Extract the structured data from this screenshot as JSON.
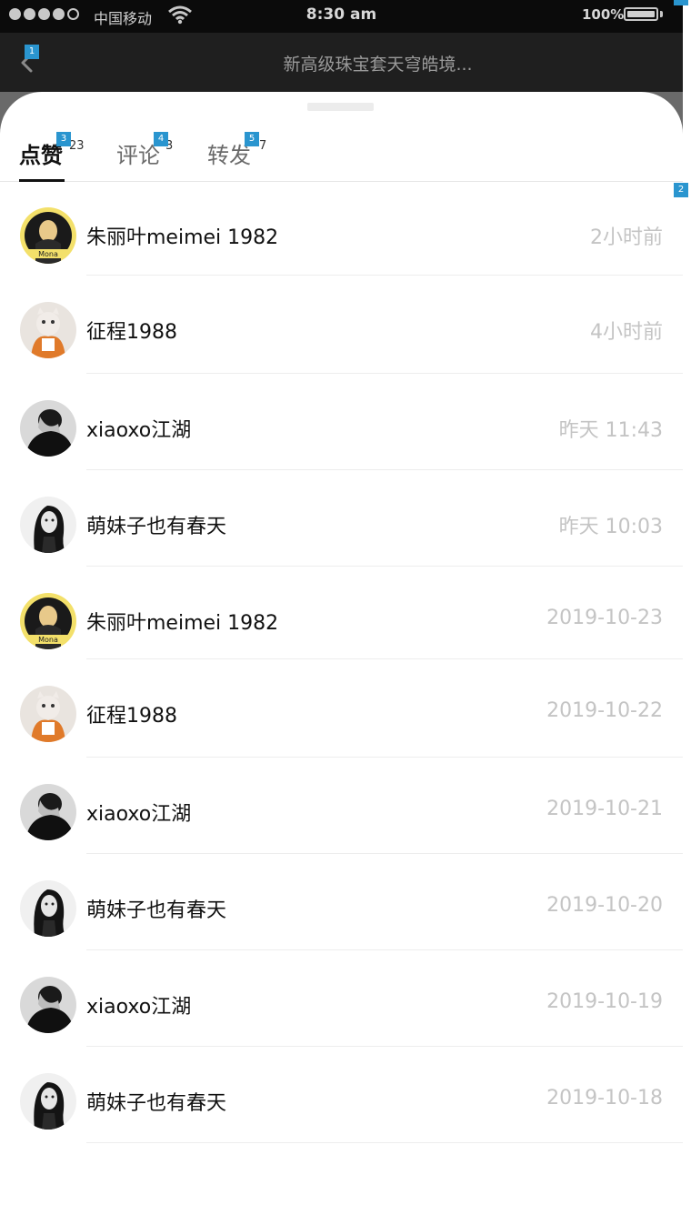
{
  "status_bar": {
    "carrier": "中国移动",
    "time": "8:30 am",
    "battery_percent": "100%",
    "battery_level": 1.0,
    "signal_bars": 5,
    "signal_filled": 4,
    "icons": [
      "signal-icon",
      "wifi-icon",
      "battery-icon"
    ]
  },
  "nav": {
    "title": "新高级珠宝套天穹皓境...",
    "back_icon": "chevron-left-icon"
  },
  "tabs": [
    {
      "label": "点赞",
      "count": "23",
      "active": true
    },
    {
      "label": "评论",
      "count": "3",
      "active": false
    },
    {
      "label": "转发",
      "count": "7",
      "active": false
    }
  ],
  "list": [
    {
      "name": "朱丽叶meimei  1982",
      "time": "2小时前",
      "avatar": "mona-lisa"
    },
    {
      "name": "征程1988",
      "time": "4小时前",
      "avatar": "cat-plush"
    },
    {
      "name": "xiaoxo江湖",
      "time": "昨天 11:43",
      "avatar": "man-dark"
    },
    {
      "name": "萌妹子也有春天",
      "time": "昨天 10:03",
      "avatar": "woman-bw"
    },
    {
      "name": "朱丽叶meimei  1982",
      "time": "2019-10-23",
      "avatar": "mona-lisa"
    },
    {
      "name": "征程1988",
      "time": "2019-10-22",
      "avatar": "cat-plush"
    },
    {
      "name": "xiaoxo江湖",
      "time": "2019-10-21",
      "avatar": "man-dark"
    },
    {
      "name": "萌妹子也有春天",
      "time": "2019-10-20",
      "avatar": "woman-bw"
    },
    {
      "name": "xiaoxo江湖",
      "time": "2019-10-19",
      "avatar": "man-dark"
    },
    {
      "name": "萌妹子也有春天",
      "time": "2019-10-18",
      "avatar": "woman-bw"
    }
  ],
  "markers": [
    "0",
    "1",
    "2",
    "3",
    "4",
    "5"
  ],
  "colors": {
    "status_bg": "#0b0b0b",
    "nav_bg": "#1f1f1f",
    "dim_bg": "#6a6a6a",
    "time_text": "#c4c4c4",
    "active_tab": "#111111",
    "marker": "#2a95cf"
  }
}
